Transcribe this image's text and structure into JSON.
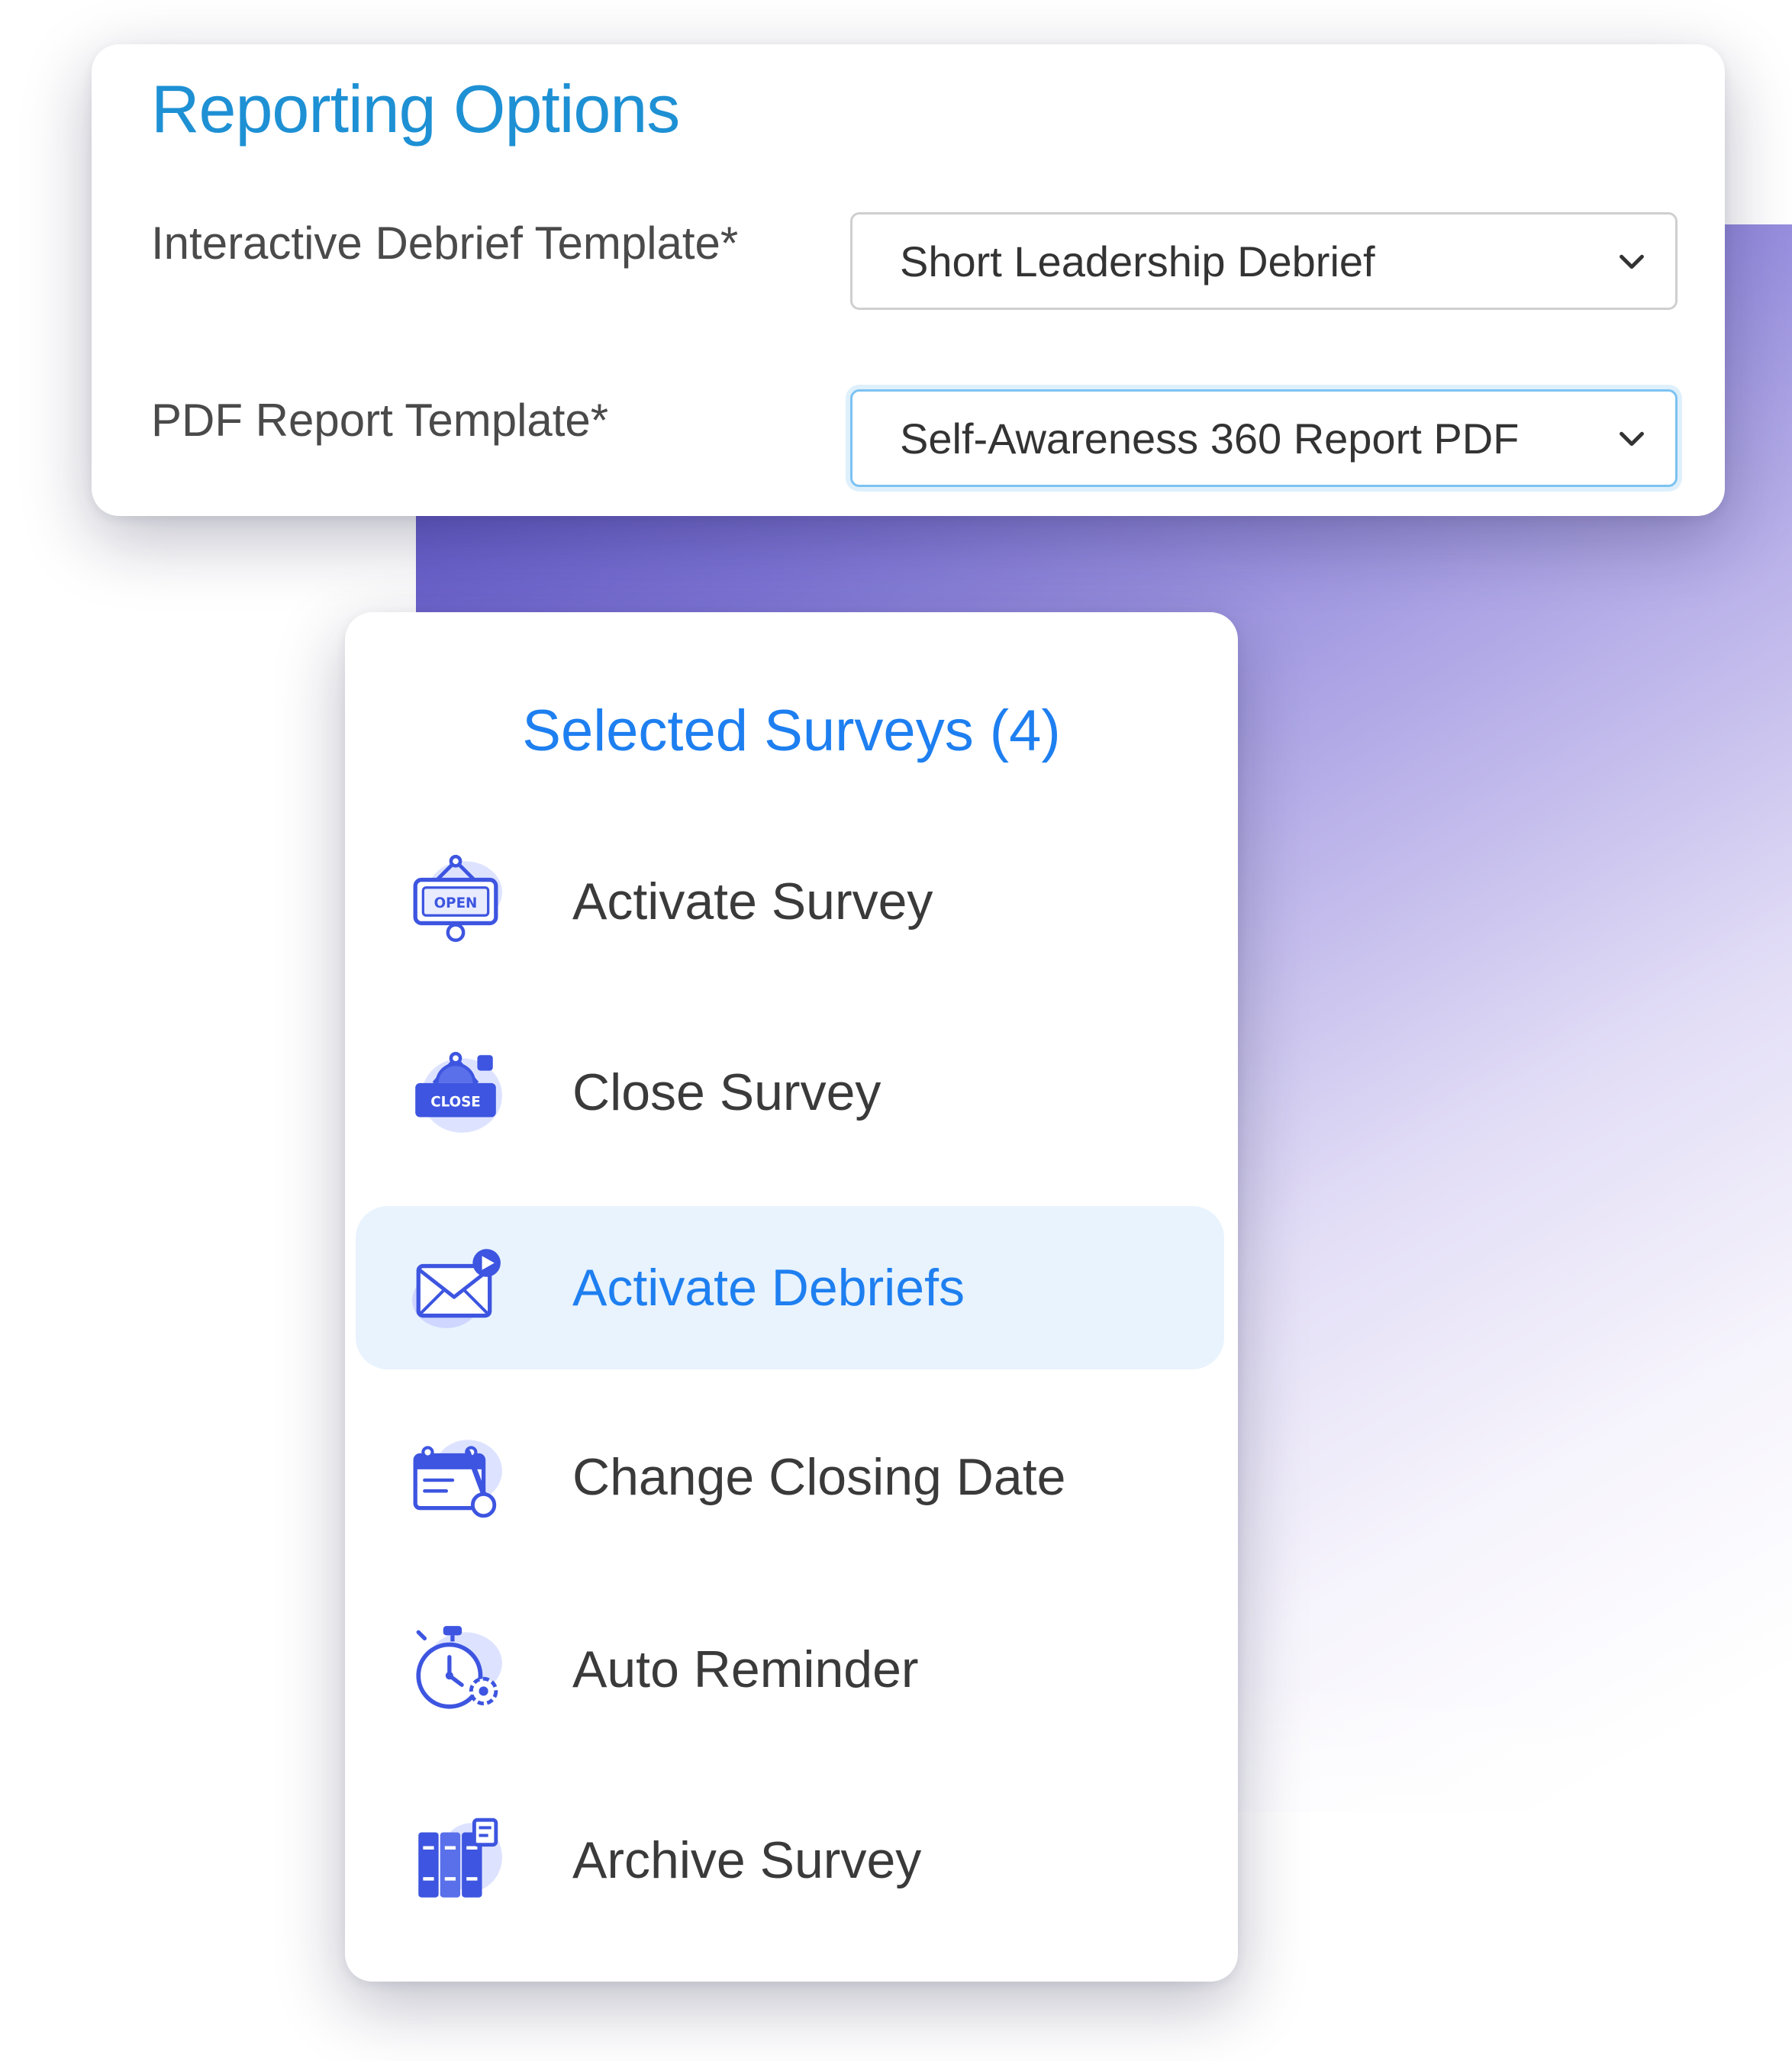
{
  "reporting": {
    "title": "Reporting Options",
    "fields": [
      {
        "label": "Interactive Debrief Template*",
        "value": "Short Leadership Debrief"
      },
      {
        "label": "PDF Report Template*",
        "value": "Self-Awareness 360 Report PDF"
      }
    ]
  },
  "surveys": {
    "title": "Selected Surveys (4)",
    "actions": [
      {
        "label": "Activate Survey",
        "icon": "open-sign-icon"
      },
      {
        "label": "Close Survey",
        "icon": "close-sign-icon"
      },
      {
        "label": "Activate Debriefs",
        "icon": "mail-play-icon",
        "active": true
      },
      {
        "label": "Change Closing Date",
        "icon": "calendar-edit-icon"
      },
      {
        "label": "Auto Reminder",
        "icon": "stopwatch-gear-icon"
      },
      {
        "label": "Archive Survey",
        "icon": "archive-binders-icon"
      }
    ]
  },
  "icon_text": {
    "open": "OPEN",
    "close": "CLOSE"
  },
  "colors": {
    "accent": "#1e7ff0",
    "title_blue": "#1e90d4",
    "icon_blue": "#3d55e0",
    "icon_blob": "#dde3ff",
    "active_bg": "#e8f3fd"
  }
}
